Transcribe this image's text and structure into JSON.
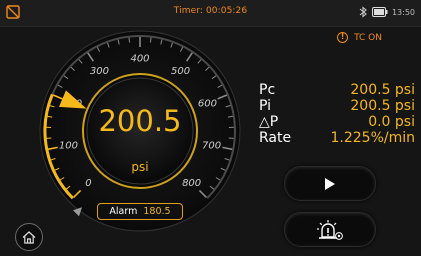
{
  "status_bar": {
    "timer": "Timer: 00:05:26",
    "clock": "13:50",
    "icons": [
      "no-bluetooth-icon",
      "bluetooth-icon",
      "battery-icon"
    ]
  },
  "indicator": {
    "label": "TC ON",
    "icon": "warning-circle-icon",
    "color": "#f08a1c"
  },
  "gauge": {
    "value": "200.5",
    "unit": "psi",
    "value_numeric": 200.5,
    "min": 0,
    "max": 800,
    "tick_labels": [
      "0",
      "100",
      "200",
      "300",
      "400",
      "500",
      "600",
      "700",
      "800"
    ],
    "alarm_label": "Alarm",
    "alarm_value": "180.5",
    "accent_color": "#f5b91c"
  },
  "readings": [
    {
      "label": "Pc",
      "value": "200.5 psi"
    },
    {
      "label": "Pi",
      "value": "200.5 psi"
    },
    {
      "label": "△P",
      "value": "0.0 psi"
    },
    {
      "label": "Rate",
      "value": "1.225%/min"
    }
  ],
  "buttons": {
    "play_icon": "play-icon",
    "alarm_settings_icon": "alarm-light-icon",
    "home_icon": "home-icon"
  }
}
